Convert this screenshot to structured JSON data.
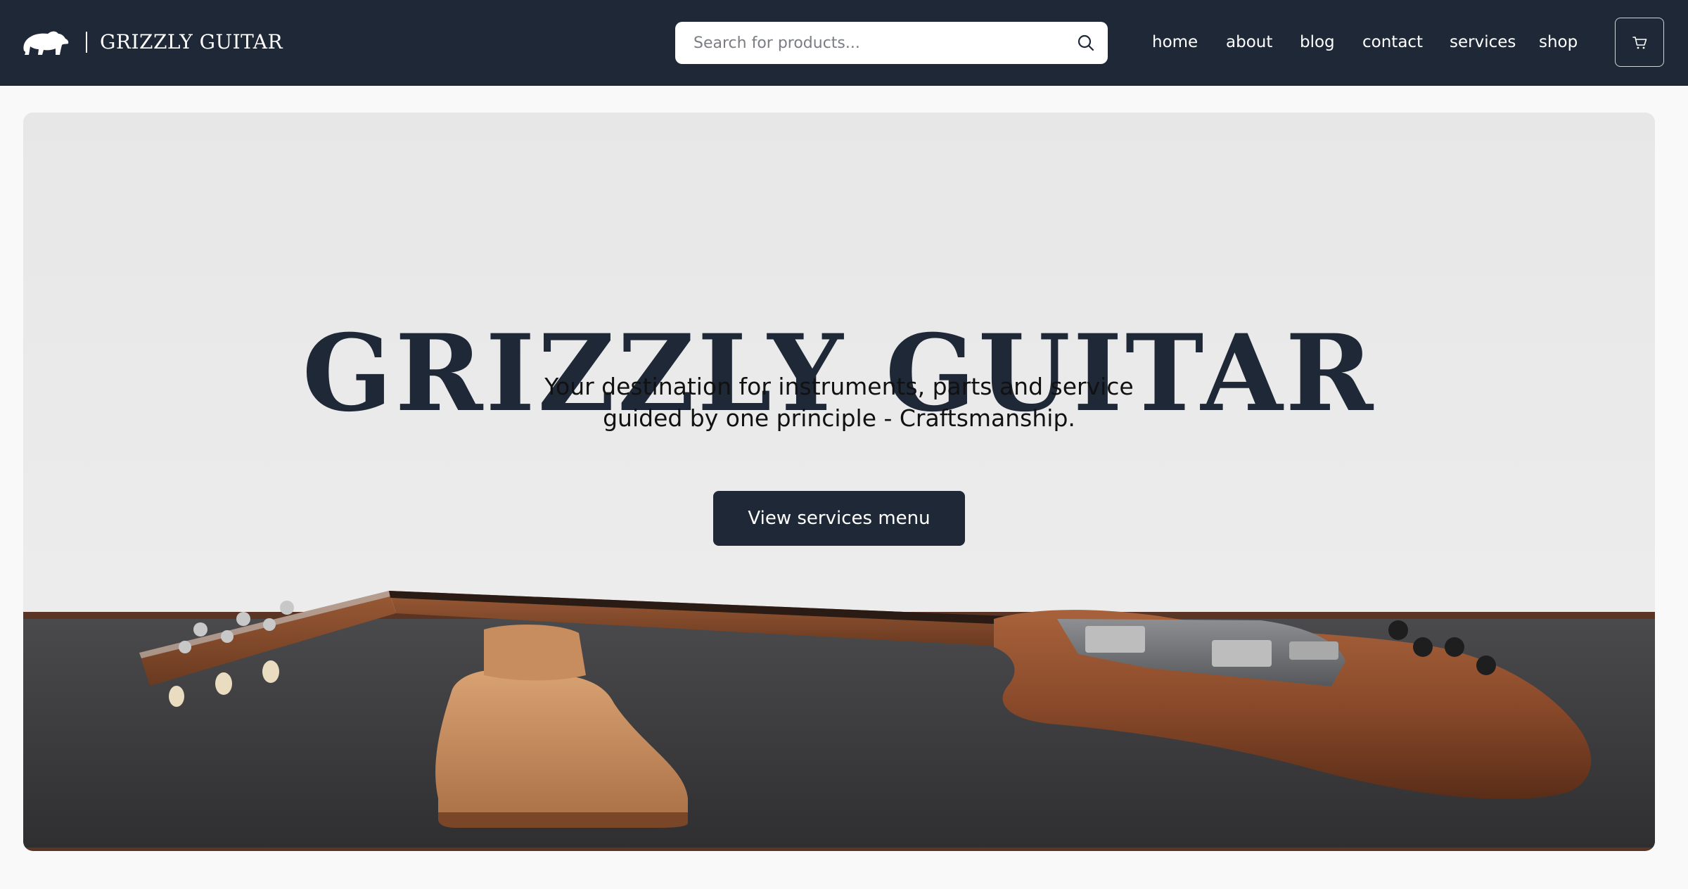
{
  "header": {
    "brand": "GRIZZLY GUITAR",
    "search_placeholder": "Search for products...",
    "nav": [
      "home",
      "about",
      "blog",
      "contact",
      "services",
      "shop"
    ]
  },
  "hero": {
    "title": "GRIZZLY GUITAR",
    "subtitle_line1": "Your destination for instruments, parts and service",
    "subtitle_line2": "guided by one principle - Craftsmanship.",
    "cta_label": "View services menu"
  },
  "colors": {
    "header_bg": "#1f2837",
    "page_bg": "#f9f9f9",
    "cta_bg": "#1f2837",
    "title_color": "#1f2837"
  },
  "icons": {
    "logo": "bear-icon",
    "search": "search-icon",
    "cart": "cart-icon"
  }
}
